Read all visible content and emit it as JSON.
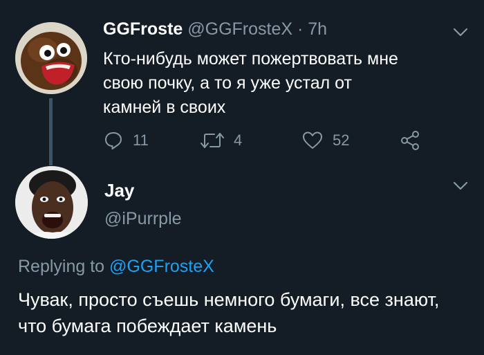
{
  "tweet": {
    "author_name": "GGFroste",
    "author_handle": "@GGFrosteX",
    "separator": "·",
    "time": "7h",
    "text_lines": [
      "Кто-нибудь может пожертвовать мне",
      "свою почку, а то я  уже устал от",
      "камней в своих"
    ],
    "actions": {
      "reply_icon": "reply-icon",
      "reply_count": "11",
      "retweet_icon": "retweet-icon",
      "retweet_count": "4",
      "like_icon": "heart-icon",
      "like_count": "52",
      "share_icon": "share-icon"
    },
    "menu_icon": "chevron-down-icon"
  },
  "reply": {
    "author_name": "Jay",
    "author_handle": "@iPurrple",
    "replying_prefix": "Replying to",
    "replying_mention": "@GGFrosteX",
    "text_lines": [
      "Чувак, просто съешь немного бумаги, все знают,",
      "что бумага побеждает камень"
    ],
    "menu_icon": "chevron-down-icon"
  },
  "colors": {
    "background": "#141d26",
    "muted_text": "#8899a6",
    "link": "#1da1f2",
    "thread_line": "#3d5466"
  }
}
